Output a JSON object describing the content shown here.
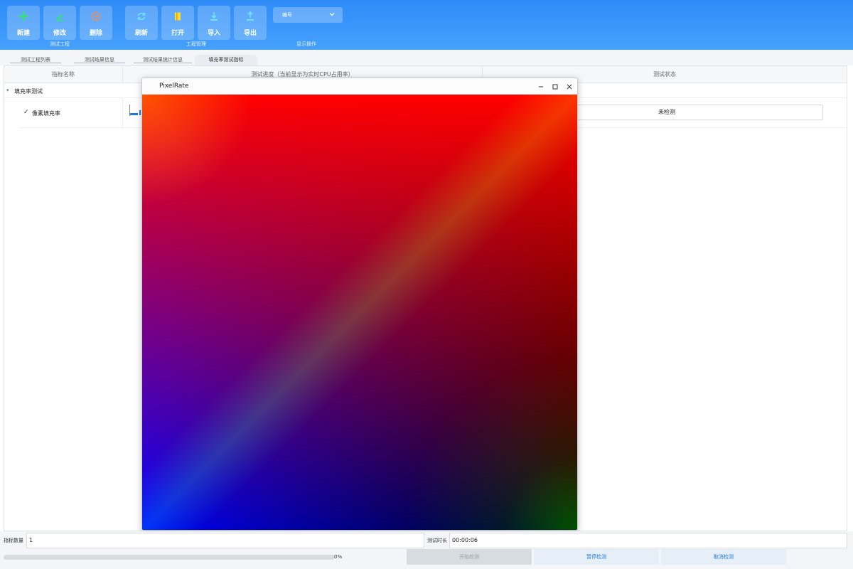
{
  "toolbar": {
    "buttons": [
      {
        "label": "新建",
        "icon": "plus-icon"
      },
      {
        "label": "修改",
        "icon": "edit-icon"
      },
      {
        "label": "删除",
        "icon": "minus-circle-icon"
      },
      {
        "label": "刷新",
        "icon": "refresh-icon"
      },
      {
        "label": "打开",
        "icon": "open-book-icon"
      },
      {
        "label": "导入",
        "icon": "import-icon"
      },
      {
        "label": "导出",
        "icon": "export-icon"
      }
    ],
    "groups": [
      "测试工程",
      "工程管理",
      "显示操作"
    ],
    "combo_value": "编号"
  },
  "tabs": [
    "测试工程列表",
    "测试结果信息",
    "测试结果统计信息",
    "填充率测试指标"
  ],
  "active_tab": 3,
  "table": {
    "headers": [
      "指标名称",
      "测试进度（当前显示为实时CPU占用率）",
      "测试状态"
    ],
    "group_row": "填充率测试",
    "item_row": {
      "name": "像素填充率",
      "status": "未检测"
    }
  },
  "window": {
    "title": "PixelRate"
  },
  "bottom": {
    "count_label": "指标数量",
    "count_value": "1",
    "duration_label": "测试时长",
    "duration_value": "00:00:06",
    "progress_percent": 0,
    "progress_text": "0%",
    "start_label": "开始检测",
    "pause_label": "暂停检测",
    "cancel_label": "取消检测"
  },
  "colors": {
    "ribbon": "#3c98fb",
    "icon_green": "#38e07a",
    "icon_orange": "#ff8a4a",
    "icon_cyan": "#6ee4ff",
    "icon_yellow": "#ffd93a",
    "accent_blue": "#1f7ae0"
  }
}
